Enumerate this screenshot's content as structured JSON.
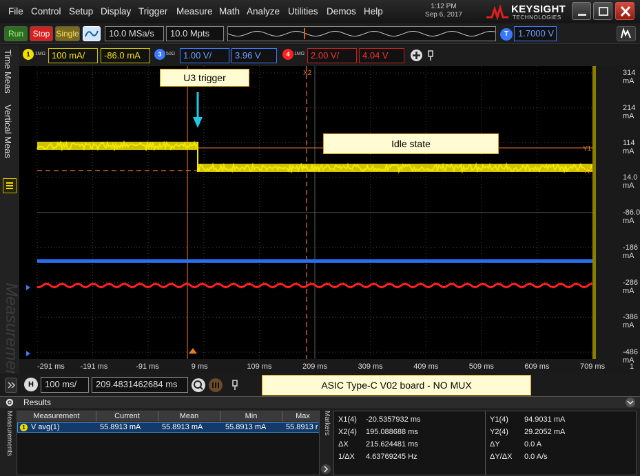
{
  "menu": [
    "File",
    "Control",
    "Setup",
    "Display",
    "Trigger",
    "Measure",
    "Math",
    "Analyze",
    "Utilities",
    "Demos",
    "Help"
  ],
  "clock": {
    "time": "1:12 PM",
    "date": "Sep 6, 2017"
  },
  "logo": {
    "brand": "KEYSIGHT",
    "sub": "TECHNOLOGIES"
  },
  "control": {
    "run": "Run",
    "stop": "Stop",
    "single": "Single",
    "sample_rate": "10.0 MSa/s",
    "memory_depth": "10.0 Mpts",
    "trigger_badge": "T",
    "trigger_level": "1.7000 V"
  },
  "channels": [
    {
      "num": "1",
      "impedance": "1MΩ",
      "scale": "100 mA/",
      "offset": "-86.0 mA",
      "color": "#f0e000"
    },
    {
      "num": "3",
      "impedance": "50Ω",
      "scale": "1.00 V/",
      "offset": "3.96 V",
      "color": "#3a78ff"
    },
    {
      "num": "4",
      "impedance": "1MΩ",
      "scale": "2.00 V/",
      "offset": "4.04 V",
      "color": "#ff2020"
    }
  ],
  "side_tabs": {
    "time": "Time Meas",
    "vertical": "Vertical Meas",
    "watermark": "Measurements"
  },
  "plot": {
    "y_ticks": [
      "314 mA",
      "214 mA",
      "114 mA",
      "14.0 mA",
      "-86.0 mA",
      "-186 mA",
      "-286 mA",
      "-386 mA",
      "-486 mA"
    ],
    "x_ticks": [
      "-291 ms",
      "-191 ms",
      "-91 ms",
      "9 ms",
      "109 ms",
      "209 ms",
      "309 ms",
      "409 ms",
      "509 ms",
      "609 ms",
      "709 ms"
    ],
    "x_page": "1",
    "markers": {
      "x2": "X2",
      "y1": "Y1",
      "y2": "Y2"
    },
    "callouts": {
      "trigger": "U3 trigger",
      "idle": "Idle state",
      "board": "ASIC Type-C V02 board - NO MUX"
    }
  },
  "timebase": {
    "h_badge": "H",
    "scale": "100 ms/",
    "position": "209.4831462684 ms"
  },
  "results": {
    "title": "Results",
    "columns": [
      "Measurement",
      "Current",
      "Mean",
      "Min",
      "Max"
    ],
    "rows": [
      {
        "measurement": "V avg(1)",
        "current": "55.8913 mA",
        "mean": "55.8913 mA",
        "min": "55.8913 mA",
        "max": "55.8913 r"
      }
    ]
  },
  "markers_panel": {
    "label": "Markers",
    "x1": {
      "label": "X1(4)",
      "value": "-20.5357932 ms"
    },
    "x2": {
      "label": "X2(4)",
      "value": "195.088688 ms"
    },
    "dx": {
      "label": "ΔX",
      "value": "215.624481 ms"
    },
    "inv_dx": {
      "label": "1/ΔX",
      "value": "4.63769245 Hz"
    },
    "y1": {
      "label": "Y1(4)",
      "value": "94.9031 mA"
    },
    "y2": {
      "label": "Y2(4)",
      "value": "29.2052 mA"
    },
    "dy": {
      "label": "ΔY",
      "value": "0.0 A"
    },
    "dydx": {
      "label": "ΔY/ΔX",
      "value": "0.0 A/s"
    }
  }
}
